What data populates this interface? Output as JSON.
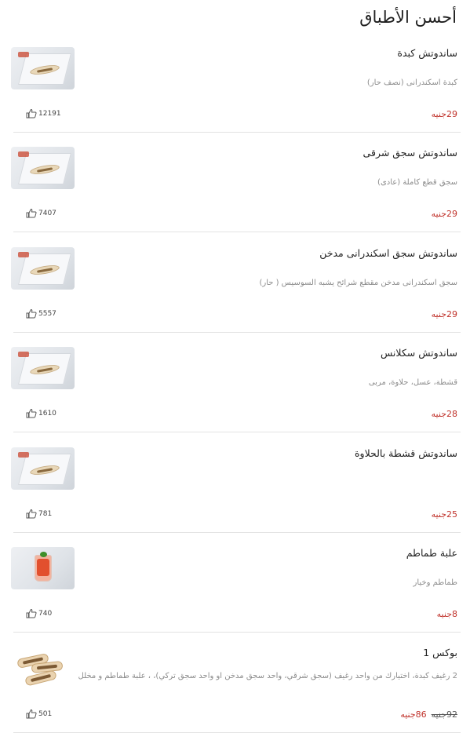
{
  "page": {
    "title": "أحسن الأطباق"
  },
  "items": [
    {
      "name": "ساندوتش كبدة",
      "description": "كبدة اسكندرانى (نصف حار)",
      "price": "29جنيه",
      "likes": "12191",
      "image": "sandwich-box-photo"
    },
    {
      "name": "ساندوتش سجق شرقى",
      "description": "سجق قطع كاملة (عادى)",
      "price": "29جنيه",
      "likes": "7407",
      "image": "sandwich-box-photo"
    },
    {
      "name": "ساندوتش سجق اسكندرانى مدخن",
      "description": "سجق اسكندرانى مدخن مقطع شرائح يشبه السوسيس ( حار)",
      "price": "29جنيه",
      "likes": "5557",
      "image": "sandwich-box-photo"
    },
    {
      "name": "ساندوتش سكلانس",
      "description": "قشطة، عسل، حلاوة، مربى",
      "price": "28جنيه",
      "likes": "1610",
      "image": "sandwich-box-photo"
    },
    {
      "name": "ساندوتش قشطة بالحلاوة",
      "description": "",
      "price": "25جنيه",
      "likes": "781",
      "image": "sandwich-box-photo"
    },
    {
      "name": "علبة طماطم",
      "description": "طماطم وخيار",
      "price": "8جنيه",
      "likes": "740",
      "image": "tomato-cup-photo"
    },
    {
      "name": "بوكس 1",
      "description": "2 رغيف كبدة، اختيارك من واحد رغيف (سجق شرقي، واحد سجق مدخن او واحد سجق تركي)، ، علبة طماطم و مخلل",
      "price": "86جنيه",
      "old_price": "92جنيه",
      "likes": "501",
      "image": "sandwich-box-combo-photo"
    }
  ],
  "colors": {
    "price": "#c0322b",
    "divider": "#e3e3e3",
    "description": "#8c8c8c"
  },
  "icons": {
    "like": "thumbs-up-icon"
  }
}
